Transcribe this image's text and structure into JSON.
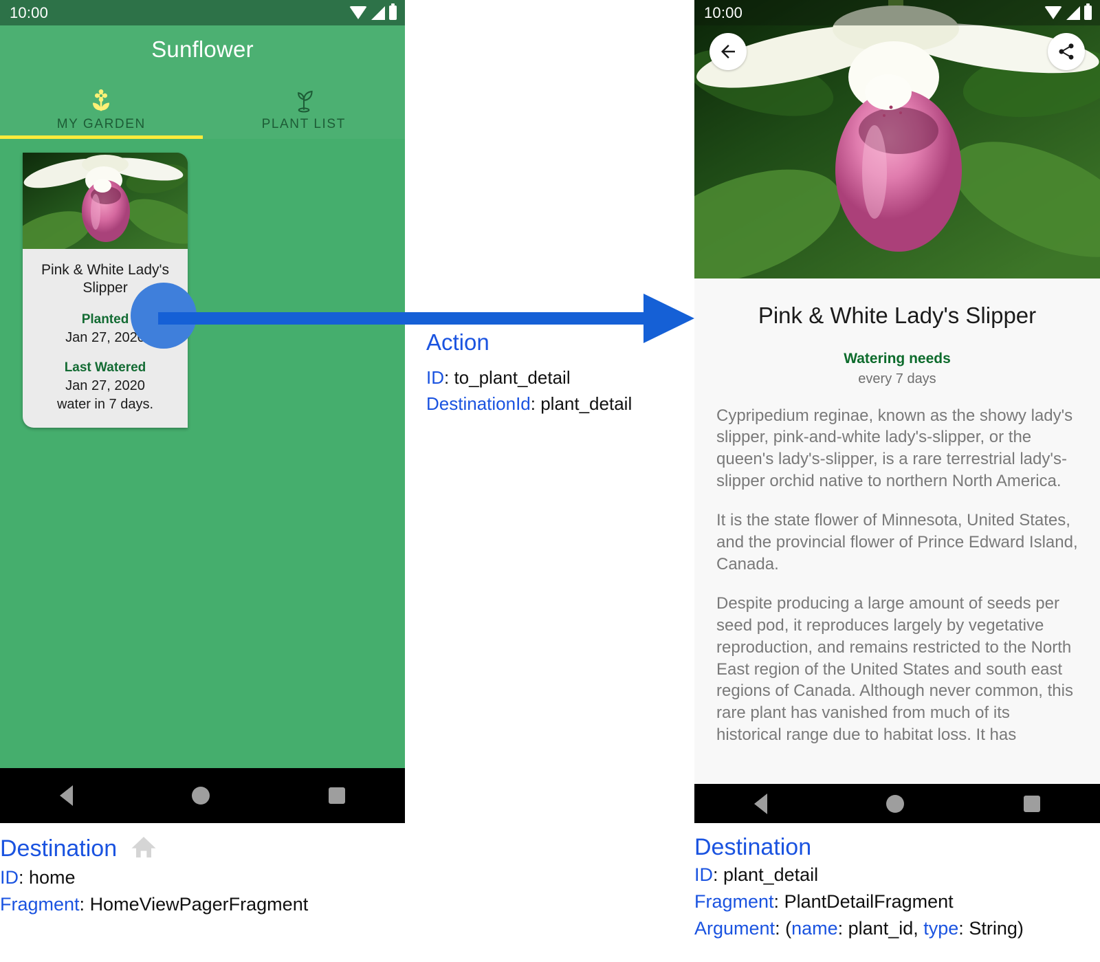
{
  "left_phone": {
    "status_bar": {
      "time": "10:00",
      "icons": [
        "wifi-icon",
        "signal-icon",
        "battery-icon"
      ]
    },
    "app_bar": {
      "title": "Sunflower"
    },
    "tabs": [
      {
        "label": "MY GARDEN",
        "icon": "flower-icon",
        "active": true
      },
      {
        "label": "PLANT LIST",
        "icon": "sprout-icon",
        "active": false
      }
    ],
    "card": {
      "image_alt": "pink-and-white-lady-slipper-photo",
      "title": "Pink & White Lady's Slipper",
      "planted_label": "Planted",
      "planted_value": "Jan 27, 2020",
      "watered_label": "Last Watered",
      "watered_value": "Jan 27, 2020",
      "water_note": "water in 7 days."
    },
    "nav_bar": {
      "back": "back-triangle-icon",
      "home": "home-circle-icon",
      "recents": "recents-square-icon"
    }
  },
  "action": {
    "heading": "Action",
    "id_key": "ID",
    "id_value": "to_plant_detail",
    "destination_key": "DestinationId",
    "destination_value": "plant_detail"
  },
  "right_phone": {
    "status_bar": {
      "time": "10:00",
      "icons": [
        "wifi-icon",
        "signal-icon",
        "battery-icon"
      ]
    },
    "hero": {
      "back_icon": "arrow-back-icon",
      "share_icon": "share-icon",
      "image_alt": "pink-and-white-lady-slipper-hero-photo"
    },
    "detail": {
      "title": "Pink & White Lady's Slipper",
      "watering_label": "Watering needs",
      "watering_value": "every 7 days",
      "paragraphs": [
        "Cypripedium reginae, known as the showy lady's slipper, pink-and-white lady's-slipper, or the queen's lady's-slipper, is a rare terrestrial lady's-slipper orchid native to northern North America.",
        "It is the state flower of Minnesota, United States, and the provincial flower of Prince Edward Island, Canada.",
        "Despite producing a large amount of seeds per seed pod, it reproduces largely by vegetative reproduction, and remains restricted to the North East region of the United States and south east regions of Canada. Although never common, this rare plant has vanished from much of its historical range due to habitat loss. It has"
      ]
    },
    "nav_bar": {
      "back": "back-triangle-icon",
      "home": "home-circle-icon",
      "recents": "recents-square-icon"
    }
  },
  "destination_left": {
    "heading": "Destination",
    "icon": "home-icon",
    "id_key": "ID",
    "id_value": "home",
    "fragment_key": "Fragment",
    "fragment_value": "HomeViewPagerFragment"
  },
  "destination_right": {
    "heading": "Destination",
    "id_key": "ID",
    "id_value": "plant_detail",
    "fragment_key": "Fragment",
    "fragment_value": "PlantDetailFragment",
    "argument_key": "Argument",
    "argument_open": "(",
    "argument_name_key": "name",
    "argument_name_value": "plant_id,",
    "argument_type_key": "type",
    "argument_type_value": "String)"
  },
  "colors": {
    "status_bar_green": "#2d7248",
    "app_bar_green": "#4cb072",
    "body_green": "#45ae6d",
    "tab_indicator_yellow": "#ffeb3b",
    "accent_blue": "#1a53e0",
    "arrow_blue": "#1560d6",
    "dot_blue": "#3f7fdb",
    "label_green": "#136b33"
  }
}
